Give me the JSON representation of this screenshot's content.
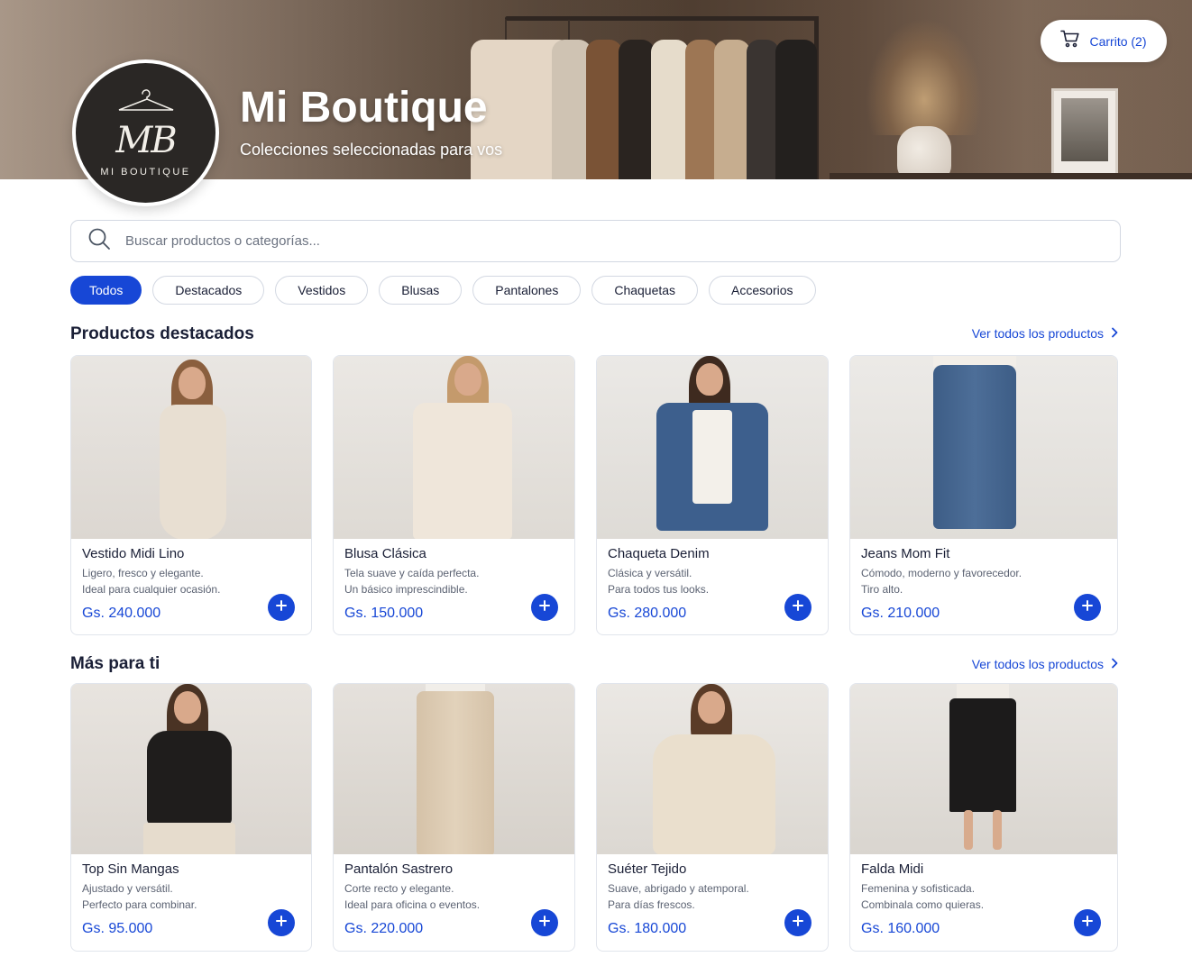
{
  "store": {
    "title": "Mi Boutique",
    "subtitle": "Colecciones seleccionadas para vos",
    "logo_monogram": "MB",
    "logo_text": "MI BOUTIQUE"
  },
  "cart": {
    "label": "Carrito (2)",
    "icon": "cart-icon"
  },
  "search": {
    "placeholder": "Buscar productos o categorías...",
    "value": "",
    "icon": "search-icon"
  },
  "filters": [
    {
      "label": "Todos",
      "active": true
    },
    {
      "label": "Destacados",
      "active": false
    },
    {
      "label": "Vestidos",
      "active": false
    },
    {
      "label": "Blusas",
      "active": false
    },
    {
      "label": "Pantalones",
      "active": false
    },
    {
      "label": "Chaquetas",
      "active": false
    },
    {
      "label": "Accesorios",
      "active": false
    }
  ],
  "sections": [
    {
      "title": "Productos destacados",
      "see_all": "Ver todos los productos",
      "products": [
        {
          "name": "Vestido Midi Lino",
          "desc1": "Ligero, fresco y elegante.",
          "desc2": "Ideal para cualquier ocasión.",
          "price": "Gs. 240.000"
        },
        {
          "name": "Blusa Clásica",
          "desc1": "Tela suave y caída perfecta.",
          "desc2": "Un básico imprescindible.",
          "price": "Gs. 150.000"
        },
        {
          "name": "Chaqueta Denim",
          "desc1": "Clásica y versátil.",
          "desc2": "Para todos tus looks.",
          "price": "Gs. 280.000"
        },
        {
          "name": "Jeans Mom Fit",
          "desc1": "Cómodo, moderno y favorecedor.",
          "desc2": "Tiro alto.",
          "price": "Gs. 210.000"
        }
      ]
    },
    {
      "title": "Más para ti",
      "see_all": "Ver todos los productos",
      "products": [
        {
          "name": "Top Sin Mangas",
          "desc1": "Ajustado y versátil.",
          "desc2": "Perfecto para combinar.",
          "price": "Gs. 95.000"
        },
        {
          "name": "Pantalón Sastrero",
          "desc1": "Corte recto y elegante.",
          "desc2": "Ideal para oficina o eventos.",
          "price": "Gs. 220.000"
        },
        {
          "name": "Suéter Tejido",
          "desc1": "Suave, abrigado y atemporal.",
          "desc2": "Para días frescos.",
          "price": "Gs. 180.000"
        },
        {
          "name": "Falda Midi",
          "desc1": "Femenina y sofisticada.",
          "desc2": "Combinala como quieras.",
          "price": "Gs. 160.000"
        }
      ]
    }
  ],
  "colors": {
    "accent": "#1747d6",
    "text": "#1a1f36",
    "muted": "#5b6272",
    "border": "#e1e5ec"
  }
}
